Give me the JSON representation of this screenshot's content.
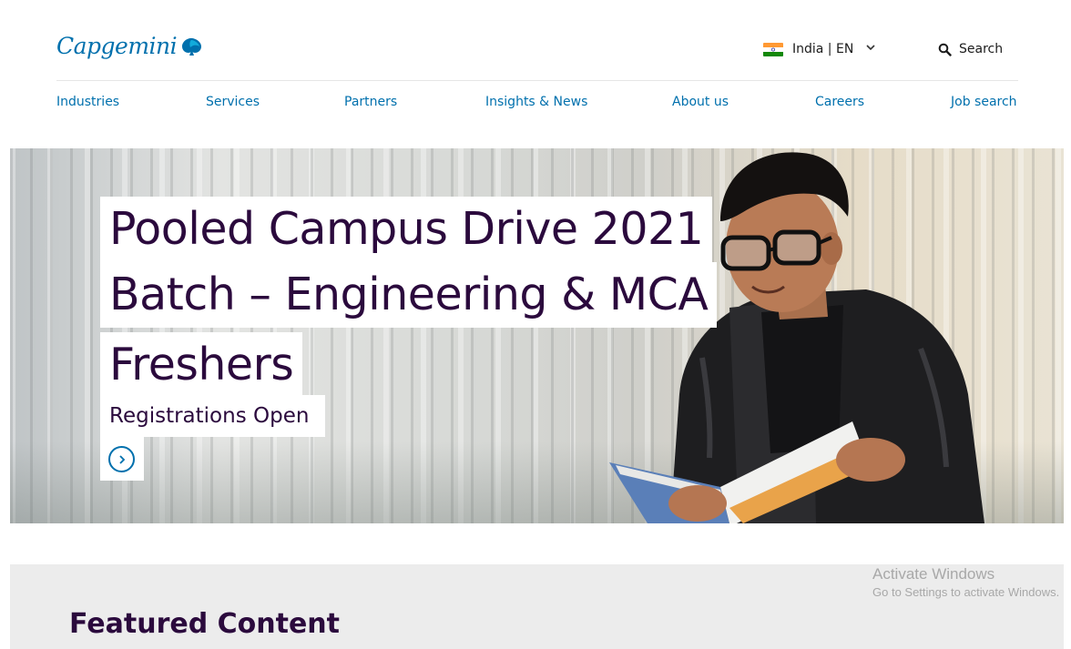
{
  "header": {
    "logo_text": "Capgemini",
    "locale_label": "India | EN",
    "search_label": "Search"
  },
  "nav": {
    "items": [
      {
        "label": "Industries"
      },
      {
        "label": "Services"
      },
      {
        "label": "Partners"
      },
      {
        "label": "Insights & News"
      },
      {
        "label": "About us"
      },
      {
        "label": "Careers"
      },
      {
        "label": "Job search"
      }
    ]
  },
  "hero": {
    "title_lines": [
      "Pooled Campus Drive 2021",
      "Batch – Engineering & MCA",
      "Freshers"
    ],
    "subtitle": "Registrations Open"
  },
  "featured": {
    "title": "Featured Content"
  },
  "watermark": {
    "line1": "Activate Windows",
    "line2": "Go to Settings to activate Windows."
  },
  "colors": {
    "brand_blue": "#0070ad",
    "heading_purple": "#2b0a3d",
    "featured_bg": "#ececec"
  },
  "icons": [
    "capgemini-spade-icon",
    "india-flag-icon",
    "chevron-down-icon",
    "search-icon",
    "arrow-right-circle-icon"
  ]
}
